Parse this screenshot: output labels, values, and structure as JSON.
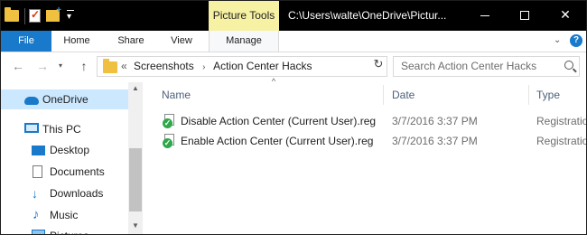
{
  "titlebar": {
    "context_tab_label": "Picture Tools",
    "title": "C:\\Users\\walte\\OneDrive\\Pictur...",
    "minimize": "",
    "maximize": "",
    "close": "✕"
  },
  "ribbon": {
    "tabs": [
      {
        "label": "File"
      },
      {
        "label": "Home"
      },
      {
        "label": "Share"
      },
      {
        "label": "View"
      },
      {
        "label": "Manage"
      }
    ],
    "expand_glyph": "⌄",
    "help_glyph": "?"
  },
  "navigation": {
    "back_glyph": "←",
    "forward_glyph": "→",
    "recent_glyph": "▾",
    "up_glyph": "↑",
    "overflow_glyph": "«",
    "breadcrumbs": [
      {
        "label": "Screenshots"
      },
      {
        "label": "Action Center Hacks"
      }
    ],
    "crumb_separator": "›",
    "dropdown_glyph": "⌄",
    "refresh_glyph": "↻"
  },
  "search": {
    "placeholder": "Search Action Center Hacks"
  },
  "nav_pane": {
    "items": [
      {
        "label": "OneDrive",
        "icon": "onedrive-cloud-icon",
        "selected": true
      },
      {
        "label": "This PC",
        "icon": "this-pc-icon"
      },
      {
        "label": "Desktop",
        "icon": "desktop-icon"
      },
      {
        "label": "Documents",
        "icon": "documents-icon"
      },
      {
        "label": "Downloads",
        "icon": "downloads-icon"
      },
      {
        "label": "Music",
        "icon": "music-icon"
      },
      {
        "label": "Pictures",
        "icon": "pictures-icon"
      }
    ],
    "scroll_up_glyph": "▲",
    "scroll_down_glyph": "▼"
  },
  "file_list": {
    "sort_glyph": "^",
    "columns": [
      {
        "label": "Name"
      },
      {
        "label": "Date"
      },
      {
        "label": "Type"
      }
    ],
    "rows": [
      {
        "name": "Disable Action Center (Current User).reg",
        "date": "3/7/2016 3:37 PM",
        "type": "Registration"
      },
      {
        "name": "Enable Action Center (Current User).reg",
        "date": "3/7/2016 3:37 PM",
        "type": "Registration"
      }
    ]
  },
  "colors": {
    "accent": "#1979ca",
    "context_tab": "#f7f1a3",
    "selection": "#cce8ff",
    "title_bar": "#000000"
  }
}
